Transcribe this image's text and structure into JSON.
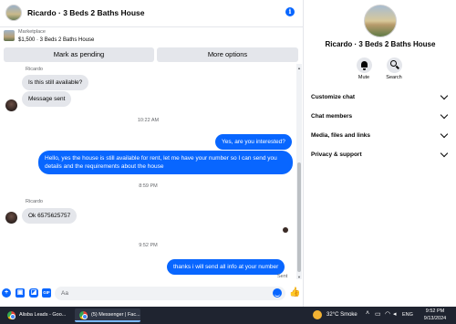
{
  "chat": {
    "title": "Ricardo · 3 Beds 2 Baths House",
    "marketplace_label": "Marketplace",
    "listing": "$1,500 · 3 Beds 2 Baths House",
    "mark_pending_label": "Mark as pending",
    "more_options_label": "More options"
  },
  "messages": [
    {
      "type": "sender",
      "text": "Ricardo"
    },
    {
      "type": "in",
      "text": "Is this still available?"
    },
    {
      "type": "in",
      "text": "Message sent"
    },
    {
      "type": "timestamp",
      "text": "10:22 AM"
    },
    {
      "type": "out",
      "text": "Yes, are you interested?"
    },
    {
      "type": "out",
      "text": "Hello, yes the house is still available for rent, let me have your number so I can send you details and the requirements about the house"
    },
    {
      "type": "timestamp",
      "text": "8:59 PM"
    },
    {
      "type": "sender",
      "text": "Ricardo"
    },
    {
      "type": "in",
      "text": "Ok 6575625757"
    },
    {
      "type": "timestamp",
      "text": "9:52 PM"
    },
    {
      "type": "out",
      "text": "thanks i will send all info at your number"
    },
    {
      "type": "status",
      "text": "Sent"
    }
  ],
  "composer": {
    "placeholder": "Aa",
    "icons": [
      "plus-icon",
      "image-icon",
      "sticker-icon",
      "gif-icon",
      "emoji-icon",
      "like-icon"
    ]
  },
  "info_panel": {
    "name": "Ricardo · 3 Beds 2 Baths House",
    "mute_label": "Mute",
    "search_label": "Search",
    "sections": [
      "Customize chat",
      "Chat members",
      "Media, files and links",
      "Privacy & support"
    ]
  },
  "taskbar": {
    "task1": "Alisba Leads - Goo...",
    "task2": "(5) Messenger | Fac...",
    "weather": "32°C  Smoke",
    "lang": "ENG",
    "time": "9:52 PM",
    "date": "9/13/2024"
  },
  "colors": {
    "accent": "#0866ff",
    "incoming_bubble": "#e4e6eb",
    "taskbar": "#1f2430"
  }
}
